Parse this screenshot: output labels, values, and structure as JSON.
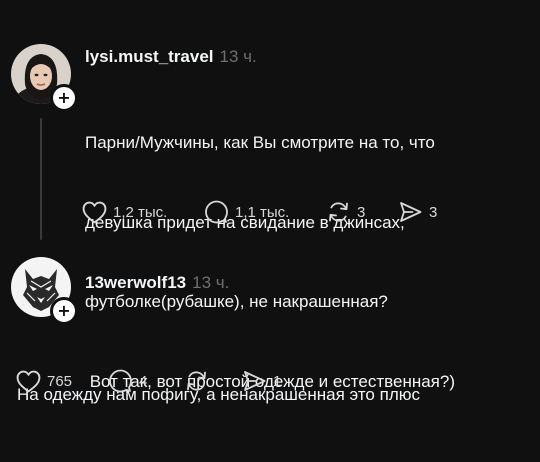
{
  "posts": [
    {
      "username": "lysi.must_travel",
      "time": "13 ч.",
      "text_lines": [
        "Парни/Мужчины, как Вы смотрите на то, что",
        "девушка придет на свидание в джинсах,",
        "футболке(рубашке), не накрашенная?",
        " Вот так, вот простой одежде и естественная?)"
      ],
      "likes": "1,2 тыс.",
      "comments": "1,1 тыс.",
      "reposts": "3",
      "shares": "3"
    },
    {
      "username": "13werwolf13",
      "time": "13 ч.",
      "text_lines": [
        "На одежду нам пофигу, а ненакрашенная это плюс"
      ],
      "likes": "765",
      "comments": "4",
      "reposts": "",
      "shares": "1"
    }
  ],
  "icons": {
    "like": "heart-icon",
    "comment": "comment-bubble-icon",
    "repost": "repost-arrows-icon",
    "share": "send-icon",
    "follow": "plus-icon"
  },
  "colors": {
    "background": "#101010",
    "text": "#f3f5f7",
    "muted": "#6f6f6f",
    "thread_line": "#3a3a3a"
  }
}
